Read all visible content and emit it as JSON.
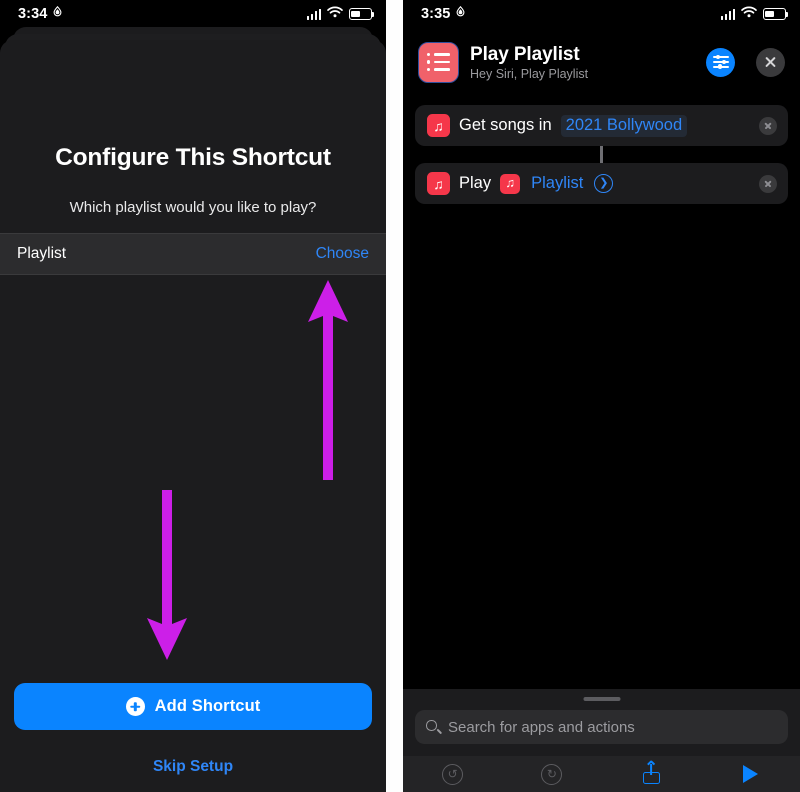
{
  "left": {
    "status": {
      "time": "3:34",
      "location_icon": "location-arrow-icon",
      "signal_icon": "cellular-signal-icon",
      "wifi_icon": "wifi-icon",
      "battery_icon": "battery-icon"
    },
    "title": "Configure This Shortcut",
    "subtitle": "Which playlist would you like to play?",
    "param": {
      "label": "Playlist",
      "action": "Choose"
    },
    "add_button": {
      "label": "Add Shortcut",
      "icon": "plus-circle-icon"
    },
    "skip_label": "Skip Setup",
    "annotations": {
      "arrow_up": "magenta-up-arrow",
      "arrow_down": "magenta-down-arrow",
      "arrow_color": "#cc1fe8"
    }
  },
  "right": {
    "status": {
      "time": "3:35"
    },
    "header": {
      "title": "Play Playlist",
      "subtitle": "Hey Siri, Play Playlist",
      "icon": "playlist-list-icon",
      "settings_button": "shortcut-settings-button",
      "close_button": "close-button"
    },
    "actions": [
      {
        "icon": "music-note-icon",
        "text": "Get songs in",
        "token": "2021 Bollywood",
        "token_style": "highlight",
        "has_chevron": false,
        "delete": "delete-action-button"
      },
      {
        "icon": "music-note-icon",
        "text": "Play",
        "inline_icon": "music-note-icon",
        "token": "Playlist",
        "token_style": "plain",
        "has_chevron": true,
        "delete": "delete-action-button"
      }
    ],
    "search": {
      "placeholder": "Search for apps and actions",
      "icon": "search-icon"
    },
    "toolbar": [
      {
        "name": "undo-button",
        "icon": "undo-icon",
        "glyph": "↺",
        "style": "gray"
      },
      {
        "name": "redo-button",
        "icon": "redo-icon",
        "glyph": "↻",
        "style": "gray"
      },
      {
        "name": "share-button",
        "icon": "share-icon",
        "style": "blue"
      },
      {
        "name": "run-button",
        "icon": "play-icon",
        "style": "blue"
      }
    ]
  },
  "colors": {
    "accent_blue": "#0a84ff",
    "link_blue": "#2f86f7",
    "music_red": "#f5374a",
    "annotation_magenta": "#cc1fe8",
    "sheet_bg": "#1c1c1e",
    "row_bg": "#2c2c2e"
  }
}
